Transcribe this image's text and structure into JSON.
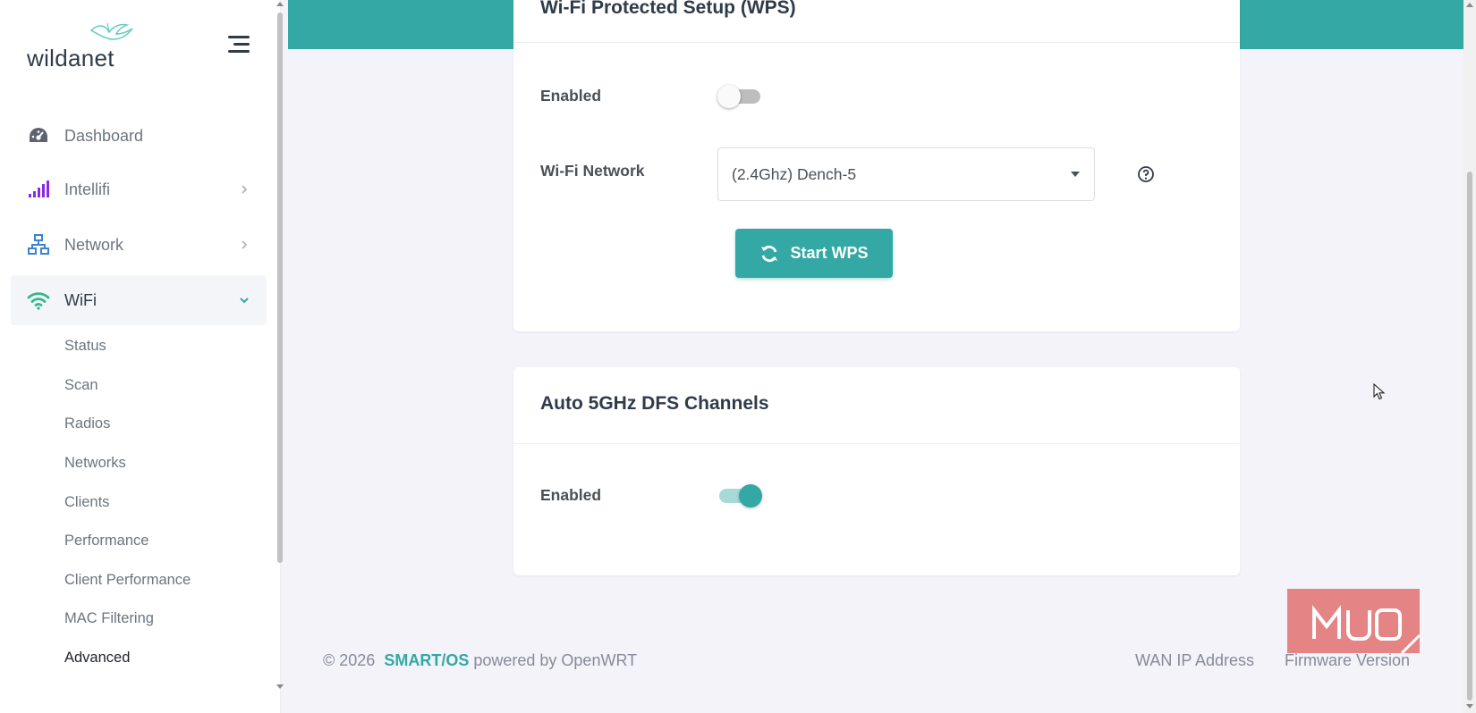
{
  "sidebar": {
    "logo_text": "wildanet",
    "nav": [
      {
        "label": "Dashboard",
        "icon": "gauge-icon"
      },
      {
        "label": "Intellifi",
        "icon": "signal-bars-icon"
      },
      {
        "label": "Network",
        "icon": "network-tree-icon"
      },
      {
        "label": "WiFi",
        "icon": "wifi-icon"
      }
    ],
    "wifi_sub": [
      "Status",
      "Scan",
      "Radios",
      "Networks",
      "Clients",
      "Performance",
      "Client Performance",
      "MAC Filtering",
      "Advanced"
    ]
  },
  "wps_card": {
    "title": "Wi-Fi Protected Setup (WPS)",
    "enabled_label": "Enabled",
    "enabled": false,
    "network_label": "Wi-Fi Network",
    "network_value": "(2.4Ghz) Dench-5",
    "button_label": "Start WPS"
  },
  "dfs_card": {
    "title": "Auto 5GHz DFS Channels",
    "enabled_label": "Enabled",
    "enabled": true
  },
  "footer": {
    "copyright": "© 2026",
    "brand": "SMART/OS",
    "powered": "powered by OpenWRT",
    "wan_ip": "WAN IP Address",
    "firmware": "Firmware Version"
  },
  "watermark": "MUO",
  "colors": {
    "accent": "#33a8a4",
    "intellifi_icon": "#8a2be2",
    "network_icon": "#3b82d6",
    "wifi_icon": "#33b88a"
  }
}
